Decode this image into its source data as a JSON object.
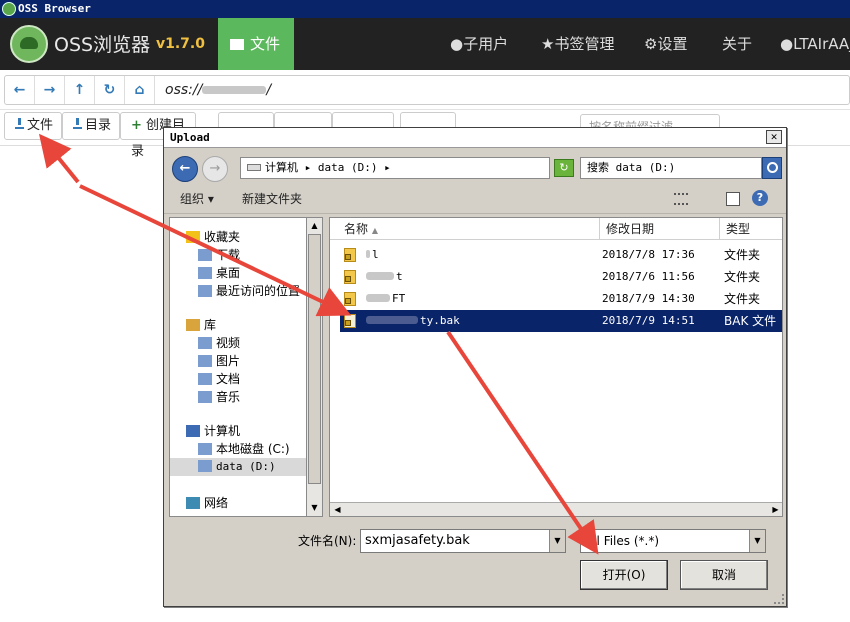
{
  "window": {
    "title": "OSS Browser"
  },
  "brand": {
    "name": "OSS浏览器",
    "version": "v1.7.0"
  },
  "nav": {
    "files": "文件",
    "subusers": "子用户",
    "bookmarks": "书签管理",
    "settings": "设置",
    "about": "关于",
    "account": "LTAIrAAj"
  },
  "address": {
    "path": "oss://"
  },
  "toolbar": {
    "upload_file": "文件",
    "upload_dir": "目录",
    "create_dir": "创建目录",
    "search_placeholder": "按名称前缀过滤"
  },
  "dialog": {
    "title": "Upload",
    "breadcrumb": "计算机 ▸ data (D:) ▸",
    "search_placeholder": "搜索 data (D:)",
    "organize": "组织 ▾",
    "new_folder": "新建文件夹",
    "left_nav": [
      {
        "label": "收藏夹",
        "icon": "star-icon",
        "level": 0
      },
      {
        "label": "下载",
        "icon": "download-folder-icon",
        "level": 1
      },
      {
        "label": "桌面",
        "icon": "desktop-icon",
        "level": 1
      },
      {
        "label": "最近访问的位置",
        "icon": "recent-places-icon",
        "level": 1
      },
      {
        "label": "库",
        "icon": "library-icon",
        "level": 0
      },
      {
        "label": "视频",
        "icon": "video-library-icon",
        "level": 1
      },
      {
        "label": "图片",
        "icon": "pictures-library-icon",
        "level": 1
      },
      {
        "label": "文档",
        "icon": "documents-library-icon",
        "level": 1
      },
      {
        "label": "音乐",
        "icon": "music-library-icon",
        "level": 1
      },
      {
        "label": "计算机",
        "icon": "computer-icon",
        "level": 0
      },
      {
        "label": "本地磁盘 (C:)",
        "icon": "local-disk-icon",
        "level": 1
      },
      {
        "label": "data (D:)",
        "icon": "drive-icon",
        "level": 1
      },
      {
        "label": "网络",
        "icon": "network-icon",
        "level": 0
      }
    ],
    "columns": {
      "name": "名称",
      "modified": "修改日期",
      "type": "类型"
    },
    "files": [
      {
        "name": "l",
        "date": "2018/7/8 17:36",
        "type": "文件夹",
        "selected": false
      },
      {
        "name": "t",
        "date": "2018/7/6 11:56",
        "type": "文件夹",
        "selected": false
      },
      {
        "name": "FT",
        "date": "2018/7/9 14:30",
        "type": "文件夹",
        "selected": false
      },
      {
        "name": "ty.bak",
        "date": "2018/7/9 14:51",
        "type": "BAK 文件",
        "selected": true
      }
    ],
    "filename_label": "文件名(N):",
    "filename_value": "sxmjasafety.bak",
    "filetype_value": "All Files (*.*)",
    "open_button": "打开(O)",
    "cancel_button": "取消"
  },
  "annotation": {
    "arrow_color": "#e8463a"
  }
}
